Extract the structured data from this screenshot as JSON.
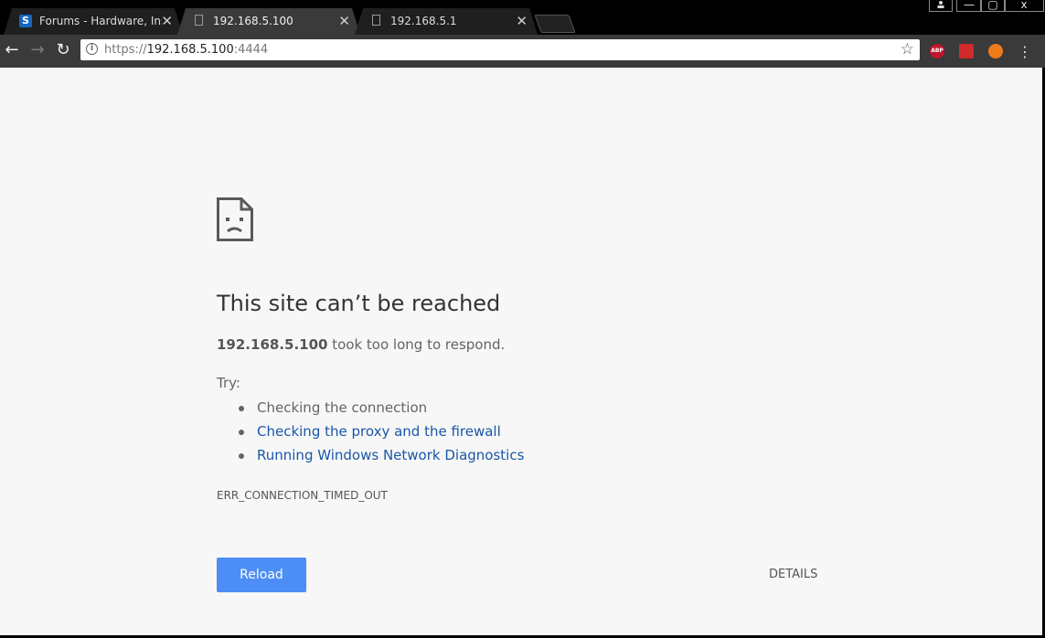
{
  "window": {
    "profile_icon": "person-icon",
    "minimize_label": "—",
    "maximize_label": "▢",
    "close_label": "x"
  },
  "tabs": [
    {
      "title": "Forums - Hardware, Insta",
      "favicon": "S",
      "active": false
    },
    {
      "title": "192.168.5.100",
      "favicon": "page-icon",
      "active": true
    },
    {
      "title": "192.168.5.1",
      "favicon": "page-icon",
      "active": false
    }
  ],
  "toolbar": {
    "back_icon": "←",
    "forward_icon": "→",
    "reload_icon": "↻",
    "url": {
      "scheme": "https://",
      "host": "192.168.5.100",
      "port": ":4444"
    },
    "info_icon": "i",
    "star_icon": "☆",
    "extensions": [
      {
        "name": "adblock-plus",
        "label": "ABP"
      },
      {
        "name": "red-extension",
        "label": ""
      },
      {
        "name": "fire-extension",
        "label": ""
      }
    ],
    "menu_icon": "⋮"
  },
  "error_page": {
    "headline": "This site can’t be reached",
    "host": "192.168.5.100",
    "summary_rest": " took too long to respond.",
    "try_label": "Try:",
    "suggestions": [
      {
        "text": "Checking the connection",
        "link": false
      },
      {
        "text": "Checking the proxy and the firewall",
        "link": true
      },
      {
        "text": "Running Windows Network Diagnostics",
        "link": true
      }
    ],
    "error_code": "ERR_CONNECTION_TIMED_OUT",
    "reload_label": "Reload",
    "details_label": "DETAILS"
  },
  "colors": {
    "link": "#1a56a8",
    "button": "#4c8df6",
    "page_bg": "#f7f7f7",
    "chrome_dark": "#3a3a3a"
  }
}
